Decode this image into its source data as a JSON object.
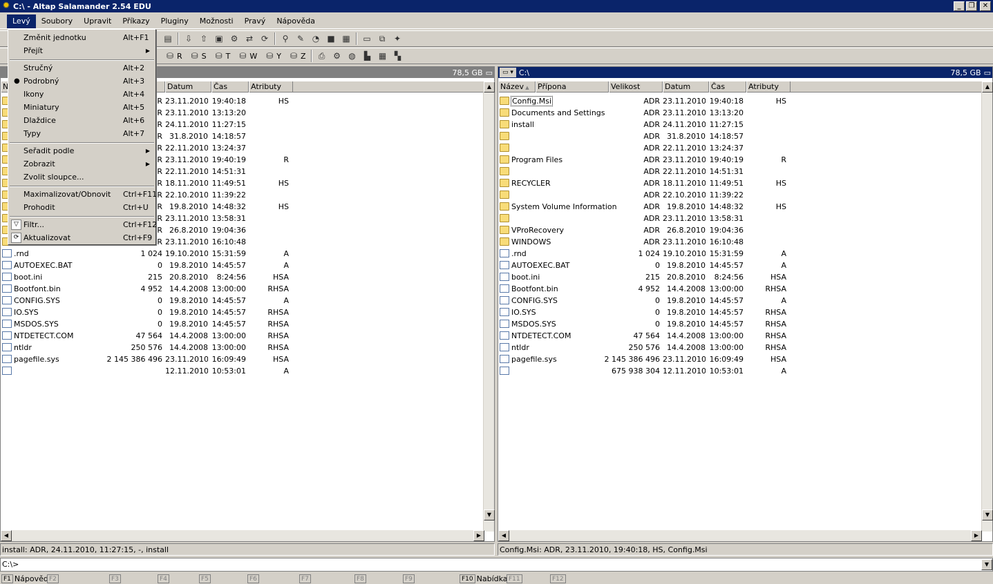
{
  "window": {
    "title": "C:\\ - Altap Salamander 2.54 EDU"
  },
  "menubar": [
    "Levý",
    "Soubory",
    "Upravit",
    "Příkazy",
    "Pluginy",
    "Možnosti",
    "Pravý",
    "Nápověda"
  ],
  "toolbar_drives": [
    "R",
    "S",
    "T",
    "W",
    "Y",
    "Z"
  ],
  "left_panel": {
    "free": "78,5 GB",
    "columns": [
      "N",
      "Datum",
      "Čas",
      "Atributy"
    ],
    "rows": [
      {
        "name": "",
        "size": "R",
        "date": "23.11.2010",
        "time": "19:40:18",
        "attr": "HS",
        "dir": true
      },
      {
        "name": "",
        "size": "R",
        "date": "23.11.2010",
        "time": "13:13:20",
        "attr": "",
        "dir": true
      },
      {
        "name": "",
        "size": "R",
        "date": "24.11.2010",
        "time": "11:27:15",
        "attr": "",
        "dir": true
      },
      {
        "name": "",
        "size": "R",
        "date": "31.8.2010",
        "time": "14:18:57",
        "attr": "",
        "dir": true
      },
      {
        "name": "",
        "size": "R",
        "date": "22.11.2010",
        "time": "13:24:37",
        "attr": "",
        "dir": true
      },
      {
        "name": "",
        "size": "R",
        "date": "23.11.2010",
        "time": "19:40:19",
        "attr": "R",
        "dir": true
      },
      {
        "name": "",
        "size": "R",
        "date": "22.11.2010",
        "time": "14:51:31",
        "attr": "",
        "dir": true
      },
      {
        "name": "",
        "size": "R",
        "date": "18.11.2010",
        "time": "11:49:51",
        "attr": "HS",
        "dir": true
      },
      {
        "name": "",
        "size": "R",
        "date": "22.10.2010",
        "time": "11:39:22",
        "attr": "",
        "dir": true
      },
      {
        "name": "",
        "size": "R",
        "date": "19.8.2010",
        "time": "14:48:32",
        "attr": "HS",
        "dir": true
      },
      {
        "name": "",
        "size": "R",
        "date": "23.11.2010",
        "time": "13:58:31",
        "attr": "",
        "dir": true
      },
      {
        "name": "",
        "size": "R",
        "date": "26.8.2010",
        "time": "19:04:36",
        "attr": "",
        "dir": true
      },
      {
        "name": "",
        "size": "R",
        "date": "23.11.2010",
        "time": "16:10:48",
        "attr": "",
        "dir": true
      },
      {
        "name": ".rnd",
        "size": "1 024",
        "date": "19.10.2010",
        "time": "15:31:59",
        "attr": "A",
        "dir": false
      },
      {
        "name": "AUTOEXEC.BAT",
        "size": "0",
        "date": "19.8.2010",
        "time": "14:45:57",
        "attr": "A",
        "dir": false
      },
      {
        "name": "boot.ini",
        "size": "215",
        "date": "20.8.2010",
        "time": "8:24:56",
        "attr": "HSA",
        "dir": false
      },
      {
        "name": "Bootfont.bin",
        "size": "4 952",
        "date": "14.4.2008",
        "time": "13:00:00",
        "attr": "RHSA",
        "dir": false
      },
      {
        "name": "CONFIG.SYS",
        "size": "0",
        "date": "19.8.2010",
        "time": "14:45:57",
        "attr": "A",
        "dir": false
      },
      {
        "name": "IO.SYS",
        "size": "0",
        "date": "19.8.2010",
        "time": "14:45:57",
        "attr": "RHSA",
        "dir": false
      },
      {
        "name": "MSDOS.SYS",
        "size": "0",
        "date": "19.8.2010",
        "time": "14:45:57",
        "attr": "RHSA",
        "dir": false
      },
      {
        "name": "NTDETECT.COM",
        "size": "47 564",
        "date": "14.4.2008",
        "time": "13:00:00",
        "attr": "RHSA",
        "dir": false
      },
      {
        "name": "ntldr",
        "size": "250 576",
        "date": "14.4.2008",
        "time": "13:00:00",
        "attr": "RHSA",
        "dir": false
      },
      {
        "name": "pagefile.sys",
        "size": "2 145 386 496",
        "date": "23.11.2010",
        "time": "16:09:49",
        "attr": "HSA",
        "dir": false
      },
      {
        "name": "",
        "size": "",
        "date": "12.11.2010",
        "time": "10:53:01",
        "attr": "A",
        "dir": false
      }
    ],
    "status": "install: ADR, 24.11.2010, 11:27:15, -, install"
  },
  "right_panel": {
    "path": "C:\\",
    "free": "78,5 GB",
    "columns": [
      "Název",
      "Přípona",
      "Velikost",
      "Datum",
      "Čas",
      "Atributy"
    ],
    "rows": [
      {
        "name": "Config.Msi",
        "size": "ADR",
        "date": "23.11.2010",
        "time": "19:40:18",
        "attr": "HS",
        "dir": true
      },
      {
        "name": "Documents and Settings",
        "size": "ADR",
        "date": "23.11.2010",
        "time": "13:13:20",
        "attr": "",
        "dir": true
      },
      {
        "name": "install",
        "size": "ADR",
        "date": "24.11.2010",
        "time": "11:27:15",
        "attr": "",
        "dir": true
      },
      {
        "name": "",
        "size": "ADR",
        "date": "31.8.2010",
        "time": "14:18:57",
        "attr": "",
        "dir": true
      },
      {
        "name": "",
        "size": "ADR",
        "date": "22.11.2010",
        "time": "13:24:37",
        "attr": "",
        "dir": true
      },
      {
        "name": "Program Files",
        "size": "ADR",
        "date": "23.11.2010",
        "time": "19:40:19",
        "attr": "R",
        "dir": true
      },
      {
        "name": "",
        "size": "ADR",
        "date": "22.11.2010",
        "time": "14:51:31",
        "attr": "",
        "dir": true
      },
      {
        "name": "RECYCLER",
        "size": "ADR",
        "date": "18.11.2010",
        "time": "11:49:51",
        "attr": "HS",
        "dir": true
      },
      {
        "name": "",
        "size": "ADR",
        "date": "22.10.2010",
        "time": "11:39:22",
        "attr": "",
        "dir": true
      },
      {
        "name": "System Volume Information",
        "size": "ADR",
        "date": "19.8.2010",
        "time": "14:48:32",
        "attr": "HS",
        "dir": true
      },
      {
        "name": "",
        "size": "ADR",
        "date": "23.11.2010",
        "time": "13:58:31",
        "attr": "",
        "dir": true
      },
      {
        "name": "VProRecovery",
        "size": "ADR",
        "date": "26.8.2010",
        "time": "19:04:36",
        "attr": "",
        "dir": true
      },
      {
        "name": "WINDOWS",
        "size": "ADR",
        "date": "23.11.2010",
        "time": "16:10:48",
        "attr": "",
        "dir": true
      },
      {
        "name": ".rnd",
        "size": "1 024",
        "date": "19.10.2010",
        "time": "15:31:59",
        "attr": "A",
        "dir": false
      },
      {
        "name": "AUTOEXEC.BAT",
        "size": "0",
        "date": "19.8.2010",
        "time": "14:45:57",
        "attr": "A",
        "dir": false
      },
      {
        "name": "boot.ini",
        "size": "215",
        "date": "20.8.2010",
        "time": "8:24:56",
        "attr": "HSA",
        "dir": false
      },
      {
        "name": "Bootfont.bin",
        "size": "4 952",
        "date": "14.4.2008",
        "time": "13:00:00",
        "attr": "RHSA",
        "dir": false
      },
      {
        "name": "CONFIG.SYS",
        "size": "0",
        "date": "19.8.2010",
        "time": "14:45:57",
        "attr": "A",
        "dir": false
      },
      {
        "name": "IO.SYS",
        "size": "0",
        "date": "19.8.2010",
        "time": "14:45:57",
        "attr": "RHSA",
        "dir": false
      },
      {
        "name": "MSDOS.SYS",
        "size": "0",
        "date": "19.8.2010",
        "time": "14:45:57",
        "attr": "RHSA",
        "dir": false
      },
      {
        "name": "NTDETECT.COM",
        "size": "47 564",
        "date": "14.4.2008",
        "time": "13:00:00",
        "attr": "RHSA",
        "dir": false
      },
      {
        "name": "ntldr",
        "size": "250 576",
        "date": "14.4.2008",
        "time": "13:00:00",
        "attr": "RHSA",
        "dir": false
      },
      {
        "name": "pagefile.sys",
        "size": "2 145 386 496",
        "date": "23.11.2010",
        "time": "16:09:49",
        "attr": "HSA",
        "dir": false
      },
      {
        "name": "",
        "size": "675 938 304",
        "date": "12.11.2010",
        "time": "10:53:01",
        "attr": "A",
        "dir": false
      }
    ],
    "status": "Config.Msi: ADR, 23.11.2010, 19:40:18, HS, Config.Msi"
  },
  "cmdline": "C:\\>",
  "fkeys": [
    {
      "key": "F1",
      "label": "Nápověda"
    },
    {
      "key": "F2",
      "label": ""
    },
    {
      "key": "F3",
      "label": ""
    },
    {
      "key": "F4",
      "label": ""
    },
    {
      "key": "F5",
      "label": ""
    },
    {
      "key": "F6",
      "label": ""
    },
    {
      "key": "F7",
      "label": ""
    },
    {
      "key": "F8",
      "label": ""
    },
    {
      "key": "F9",
      "label": ""
    },
    {
      "key": "F10",
      "label": "Nabídka"
    },
    {
      "key": "F11",
      "label": ""
    },
    {
      "key": "F12",
      "label": ""
    }
  ],
  "left_menu": {
    "items": [
      {
        "label": "Změnit jednotku",
        "shortcut": "Alt+F1"
      },
      {
        "label": "Přejít",
        "submenu": true
      },
      {
        "sep": true
      },
      {
        "label": "Stručný",
        "shortcut": "Alt+2"
      },
      {
        "label": "Podrobný",
        "shortcut": "Alt+3",
        "checked": true
      },
      {
        "label": "Ikony",
        "shortcut": "Alt+4"
      },
      {
        "label": "Miniatury",
        "shortcut": "Alt+5"
      },
      {
        "label": "Dlaždice",
        "shortcut": "Alt+6"
      },
      {
        "label": "Typy",
        "shortcut": "Alt+7"
      },
      {
        "sep": true
      },
      {
        "label": "Seřadit podle",
        "submenu": true
      },
      {
        "label": "Zobrazit",
        "submenu": true
      },
      {
        "label": "Zvolit sloupce..."
      },
      {
        "sep": true
      },
      {
        "label": "Maximalizovat/Obnovit",
        "shortcut": "Ctrl+F11"
      },
      {
        "label": "Prohodit",
        "shortcut": "Ctrl+U"
      },
      {
        "sep": true
      },
      {
        "label": "Filtr...",
        "shortcut": "Ctrl+F12",
        "icon": "filter-icon"
      },
      {
        "label": "Aktualizovat",
        "shortcut": "Ctrl+F9",
        "icon": "refresh-icon"
      }
    ]
  },
  "colors": {
    "title_bar": "#0a246a",
    "face": "#d4d0c8",
    "folder": "#f8dc78"
  }
}
